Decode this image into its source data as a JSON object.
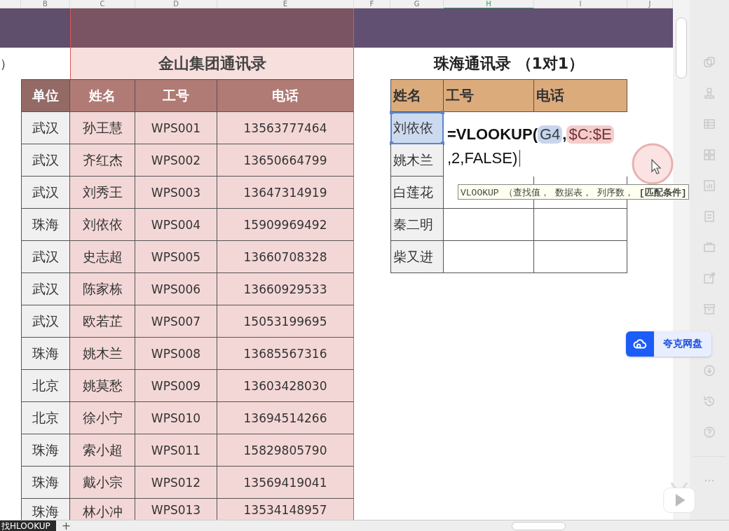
{
  "column_headers": [
    "B",
    "C",
    "D",
    "E",
    "F",
    "G",
    "H",
    "I",
    "J"
  ],
  "left_note": "）",
  "left_table": {
    "title": "金山集团通讯录",
    "columns": [
      "单位",
      "姓名",
      "工号",
      "电话"
    ],
    "rows": [
      [
        "武汉",
        "孙王慧",
        "WPS001",
        "13563777464"
      ],
      [
        "武汉",
        "齐红杰",
        "WPS002",
        "13650664799"
      ],
      [
        "武汉",
        "刘秀王",
        "WPS003",
        "13647314919"
      ],
      [
        "珠海",
        "刘依依",
        "WPS004",
        "15909969492"
      ],
      [
        "武汉",
        "史志超",
        "WPS005",
        "13660708328"
      ],
      [
        "武汉",
        "陈家栋",
        "WPS006",
        "13660929533"
      ],
      [
        "武汉",
        "欧若芷",
        "WPS007",
        "15053199695"
      ],
      [
        "珠海",
        "姚木兰",
        "WPS008",
        "13685567316"
      ],
      [
        "北京",
        "姚莫愁",
        "WPS009",
        "13603428030"
      ],
      [
        "北京",
        "徐小宁",
        "WPS010",
        "13694514266"
      ],
      [
        "珠海",
        "索小超",
        "WPS011",
        "15829805790"
      ],
      [
        "珠海",
        "戴小宗",
        "WPS012",
        "13569419041"
      ],
      [
        "珠海",
        "林小冲",
        "WPS013",
        "13534148957"
      ]
    ]
  },
  "right_table": {
    "title": "珠海通讯录 （1对1）",
    "columns": [
      "姓名",
      "工号",
      "电话"
    ],
    "rows": [
      {
        "name": "刘依依",
        "selected": true
      },
      {
        "name": "姚木兰",
        "selected": false
      },
      {
        "name": "白莲花",
        "selected": false
      },
      {
        "name": "秦二明",
        "selected": false
      },
      {
        "name": "柴又进",
        "selected": false
      }
    ]
  },
  "formula": {
    "prefix": "=VLOOKUP(",
    "ref1": "G4",
    "sep": ",",
    "ref2": "$C:$E",
    "suffix": ",2,FALSE)"
  },
  "tooltip": "VLOOKUP （查找值， 数据表， 列序数， **[匹配条件]**",
  "cloud_badge": "夸克网盘",
  "sheet_tab": "找HLOOKUP",
  "add_sheet": "+"
}
